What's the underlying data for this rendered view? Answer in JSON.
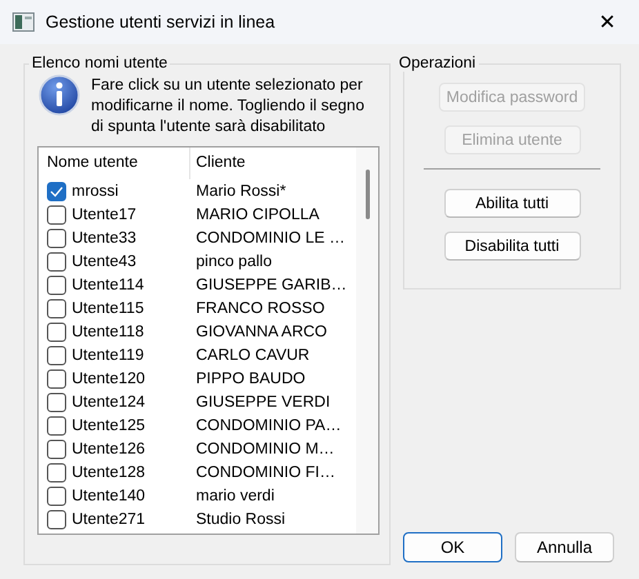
{
  "window": {
    "title": "Gestione utenti servizi in linea",
    "close": "✕"
  },
  "users_group": {
    "legend": "Elenco nomi utente",
    "info": "Fare click su un utente selezionato per modificarne il nome. Togliendo il segno di spunta l'utente sarà disabilitato",
    "columns": [
      "Nome utente",
      "Cliente"
    ],
    "rows": [
      {
        "user": "mrossi",
        "client": "Mario Rossi*",
        "checked": true
      },
      {
        "user": "Utente17",
        "client": "MARIO CIPOLLA",
        "checked": false
      },
      {
        "user": "Utente33",
        "client": "CONDOMINIO LE …",
        "checked": false
      },
      {
        "user": "Utente43",
        "client": "pinco pallo",
        "checked": false
      },
      {
        "user": "Utente114",
        "client": "GIUSEPPE GARIB…",
        "checked": false
      },
      {
        "user": "Utente115",
        "client": "FRANCO ROSSO",
        "checked": false
      },
      {
        "user": "Utente118",
        "client": "GIOVANNA ARCO",
        "checked": false
      },
      {
        "user": "Utente119",
        "client": "CARLO CAVUR",
        "checked": false
      },
      {
        "user": "Utente120",
        "client": "PIPPO BAUDO",
        "checked": false
      },
      {
        "user": "Utente124",
        "client": "GIUSEPPE VERDI",
        "checked": false
      },
      {
        "user": "Utente125",
        "client": "CONDOMINIO PA…",
        "checked": false
      },
      {
        "user": "Utente126",
        "client": "CONDOMINIO M…",
        "checked": false
      },
      {
        "user": "Utente128",
        "client": "CONDOMINIO FI…",
        "checked": false
      },
      {
        "user": "Utente140",
        "client": "mario verdi",
        "checked": false
      },
      {
        "user": "Utente271",
        "client": "Studio Rossi",
        "checked": false
      }
    ]
  },
  "operations_group": {
    "legend": "Operazioni",
    "buttons": [
      {
        "label": "Modifica password",
        "disabled": true
      },
      {
        "label": "Elimina utente",
        "disabled": true
      },
      {
        "kind": "separator"
      },
      {
        "label": "Abilita tutti",
        "disabled": false
      },
      {
        "label": "Disabilita tutti",
        "disabled": false
      }
    ]
  },
  "footer_buttons": [
    {
      "label": "OK",
      "default": true
    },
    {
      "label": "Annulla",
      "default": false
    }
  ]
}
